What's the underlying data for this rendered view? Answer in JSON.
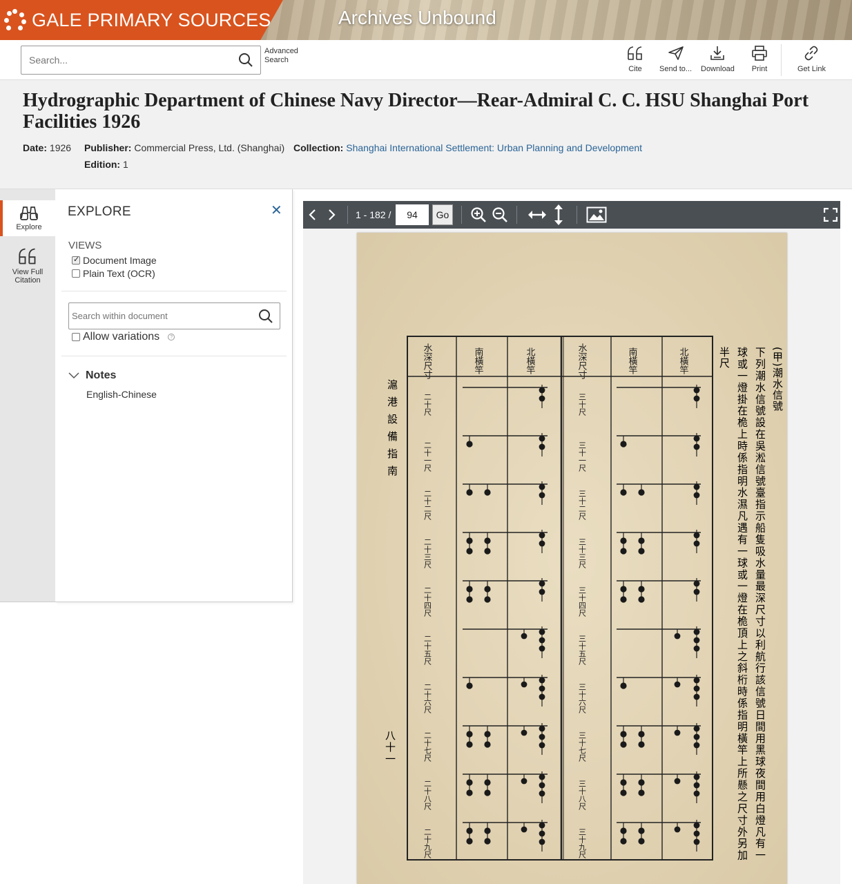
{
  "banner": {
    "brand": "GALE PRIMARY SOURCES",
    "product": "Archives Unbound"
  },
  "toolbar": {
    "search_placeholder": "Search...",
    "advanced_line1": "Advanced",
    "advanced_line2": "Search",
    "cite": "Cite",
    "send_to": "Send to...",
    "download": "Download",
    "print": "Print",
    "get_link": "Get Link"
  },
  "document": {
    "title": "Hydrographic Department of Chinese Navy Director—Rear-Admiral C. C. HSU Shanghai Port Facilities 1926",
    "date_label": "Date:",
    "date": "1926",
    "publisher_label": "Publisher:",
    "publisher": "Commercial Press, Ltd. (Shanghai)",
    "collection_label": "Collection:",
    "collection": "Shanghai International Settlement: Urban Planning and Development",
    "edition_label": "Edition:",
    "edition": "1"
  },
  "leftnav": {
    "explore": "Explore",
    "citation_line1": "View Full",
    "citation_line2": "Citation"
  },
  "explore": {
    "title": "EXPLORE",
    "views_heading": "VIEWS",
    "view_image": "Document Image",
    "view_text": "Plain Text (OCR)",
    "search_placeholder": "Search within document",
    "allow_variations": "Allow variations",
    "help": "?",
    "notes_heading": "Notes",
    "notes_value": "English-Chinese"
  },
  "viewer": {
    "page_range": "1 - 182 /",
    "current_page": "94",
    "go": "Go",
    "page_text": {
      "side_title": "滬港設備指南",
      "page_number": "八十一",
      "right_title": "(甲)潮水信號",
      "right_line1": "下列潮水信號設在吳淞信號臺指示船隻吸水量最深尺寸以利航行該信號日間用黑球夜間用白燈凡有一",
      "right_line2": "球或一燈掛在桅上時係指明水濕凡遇有一球或一燈在桅頂上之斜桁時係指明橫竿上所懸之尺寸外另加",
      "right_line3": "半尺",
      "col_depth": "水深尺寸",
      "col_south": "南橫竿",
      "col_north": "北橫竿",
      "depths_left": [
        "二十尺",
        "二十一尺",
        "二十二尺",
        "二十三尺",
        "二十四尺",
        "二十五尺",
        "二十六尺",
        "二十七尺",
        "二十八尺",
        "二十九尺"
      ],
      "depths_right": [
        "三十尺",
        "三十一尺",
        "三十二尺",
        "三十三尺",
        "三十四尺",
        "三十五尺",
        "三十六尺",
        "三十七尺",
        "三十八尺",
        "三十九尺"
      ]
    }
  },
  "colors": {
    "brand": "#d9531e",
    "link": "#2a6496",
    "viewer_bar": "#4a4f54"
  },
  "icons": [
    "search-icon",
    "quote-icon",
    "paper-plane-icon",
    "download-icon",
    "printer-icon",
    "link-icon",
    "binoculars-icon",
    "close-icon",
    "chevron-down-icon",
    "chevron-left-icon",
    "chevron-right-icon",
    "zoom-in-icon",
    "zoom-out-icon",
    "fit-width-icon",
    "fit-height-icon",
    "image-icon",
    "fullscreen-icon",
    "help-icon"
  ]
}
